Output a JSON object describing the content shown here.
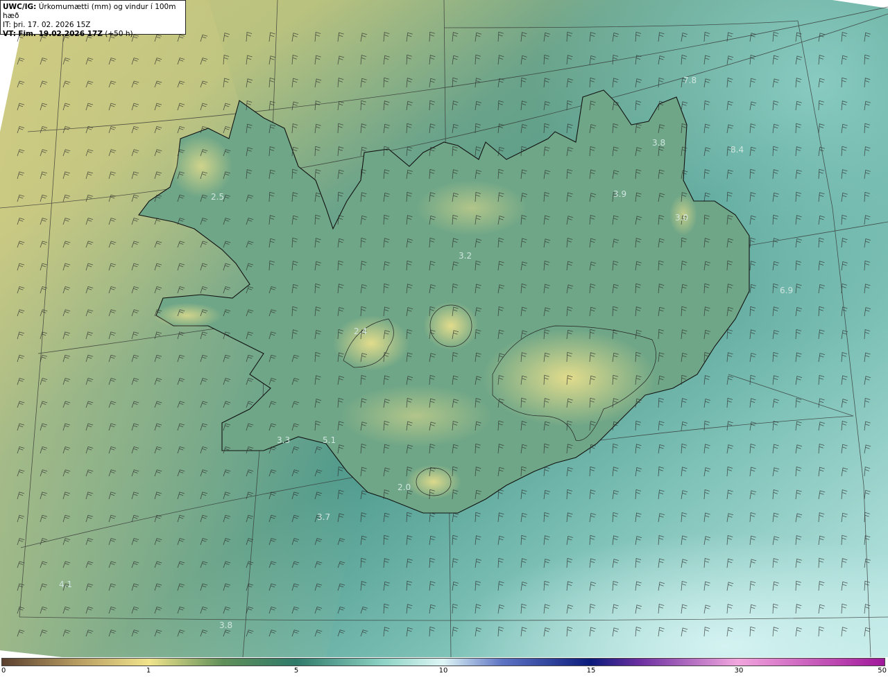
{
  "header": {
    "product": "UWC/IG:",
    "description": "Úrkomumætti (mm) og vindur í 100m hæð",
    "init_time": "IT: þri. 17. 02. 2026 15Z",
    "valid_label": "VT:",
    "valid_time": "Fim. 19.02.2026 17Z",
    "lead": "(+50 h)"
  },
  "colors": {
    "land_outline": "#111111",
    "graticule": "#333333",
    "barb": "#2a2a2a",
    "label": "#d8ebe6"
  },
  "colorbar": {
    "ticks": [
      "0",
      "1",
      "5",
      "10",
      "15",
      "30",
      "50"
    ],
    "tick_values": [
      0,
      1,
      5,
      10,
      15,
      30,
      50
    ],
    "stops": [
      {
        "v": 0,
        "c": "#5a3f2e"
      },
      {
        "v": 0.5,
        "c": "#b59a60"
      },
      {
        "v": 1,
        "c": "#f1e48c"
      },
      {
        "v": 3,
        "c": "#5f8f58"
      },
      {
        "v": 5,
        "c": "#2f7a6a"
      },
      {
        "v": 8,
        "c": "#8fd4c6"
      },
      {
        "v": 10,
        "c": "#dff6f6"
      },
      {
        "v": 12,
        "c": "#5d73c3"
      },
      {
        "v": 15,
        "c": "#0b1b7b"
      },
      {
        "v": 20,
        "c": "#6b2fa0"
      },
      {
        "v": 30,
        "c": "#f2a6de"
      },
      {
        "v": 50,
        "c": "#a0179a"
      }
    ]
  },
  "value_labels": [
    {
      "text": "7.8"
    },
    {
      "text": "2.5"
    },
    {
      "text": "3.9"
    },
    {
      "text": "3.0"
    },
    {
      "text": "3.2"
    },
    {
      "text": "3.3"
    },
    {
      "text": "5.1"
    },
    {
      "text": "3.7"
    },
    {
      "text": "4.1"
    },
    {
      "text": "3.8"
    },
    {
      "text": "2.4"
    },
    {
      "text": "2.0"
    },
    {
      "text": "3.8"
    },
    {
      "text": "8.4"
    },
    {
      "text": "6.9"
    }
  ]
}
